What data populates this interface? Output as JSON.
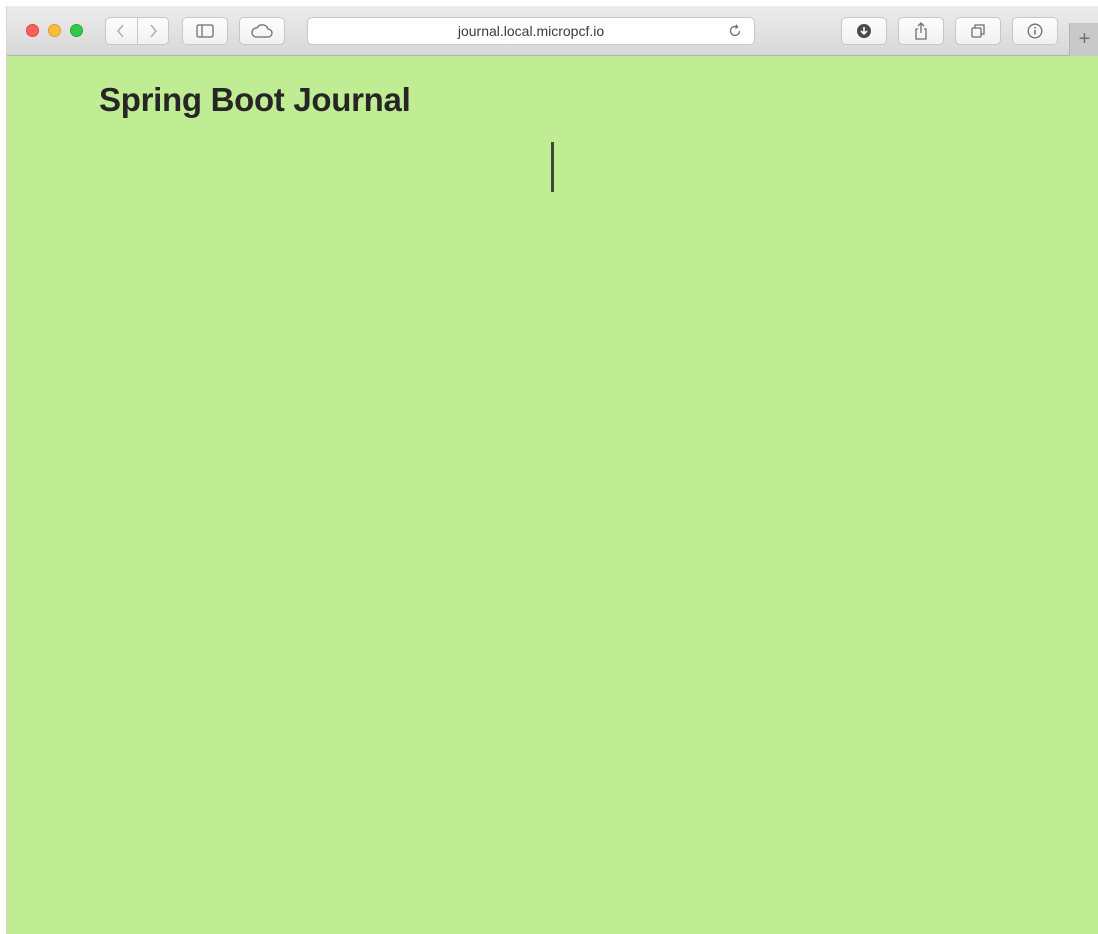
{
  "browser": {
    "url": "journal.local.micropcf.io",
    "new_tab_label": "+"
  },
  "page": {
    "title": "Spring Boot Journal",
    "background_color": "#c0ed93"
  },
  "icons": {
    "back": "chevron-left-icon",
    "forward": "chevron-right-icon",
    "sidebar": "sidebar-icon",
    "icloud": "cloud-icon",
    "reload": "reload-icon",
    "downloads": "download-icon",
    "share": "share-icon",
    "tabs": "tabs-icon",
    "info": "info-icon"
  }
}
